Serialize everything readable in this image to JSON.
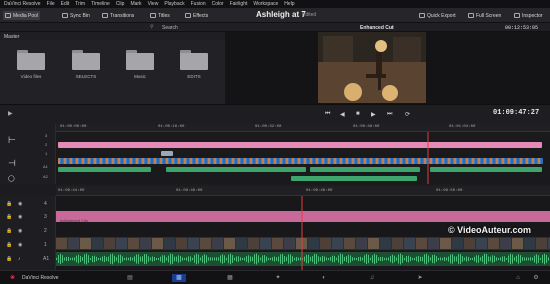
{
  "menu": [
    "DaVinci Resolve",
    "File",
    "Edit",
    "Trim",
    "Timeline",
    "Clip",
    "Mark",
    "View",
    "Playback",
    "Fusion",
    "Color",
    "Fairlight",
    "Workspace",
    "Help"
  ],
  "toolbar": {
    "media_pool": "Media Pool",
    "sync_bin": "Sync Bin",
    "transitions": "Transitions",
    "titles": "Titles",
    "effects": "Effects",
    "project_title": "Ashleigh at 7",
    "edited": "Edited",
    "quick_export": "Quick Export",
    "full_screen": "Full Screen",
    "inspector": "Inspector"
  },
  "subbar": {
    "search": "Search",
    "enhanced_cut": "Enhanced Cut",
    "timecode": "00:12:53:05"
  },
  "pool": {
    "bin": "Master",
    "folders": [
      "Video files",
      "SELECTS",
      "Music",
      "EDITS"
    ]
  },
  "transport": {
    "timecode": "01:09:47:27"
  },
  "upper_ruler": [
    "01:00:00:00",
    "01:00:16:00",
    "01:00:32:00",
    "01:00:48:00",
    "01:01:04:00"
  ],
  "lower_ruler": [
    "01:09:44:00",
    "01:09:46:00",
    "01:09:48:00",
    "01:09:50:00"
  ],
  "upper_tracks": [
    "3",
    "2",
    "1",
    "A1",
    "A2"
  ],
  "lower_tracks": [
    "4",
    "3",
    "2",
    "1",
    "A1",
    "A2"
  ],
  "clip_label": "Adjustment Clip",
  "footer": {
    "app": "DaVinci Resolve"
  },
  "watermark": "© VideoAuteur.com",
  "colors": {
    "pink": "#e58ab6",
    "green": "#3da56b",
    "blue": "#3e7fc8",
    "playhead": "#e33c3c",
    "audio_green": "#2e8a52"
  },
  "icons": [
    "media-pool-icon",
    "sync-bin-icon",
    "transitions-icon",
    "titles-icon",
    "effects-icon",
    "quick-export-icon",
    "full-screen-icon",
    "inspector-icon",
    "folder-icon",
    "play-icon",
    "stop-icon",
    "prev-icon",
    "next-icon",
    "loop-icon",
    "lock-icon",
    "eye-icon",
    "speaker-icon",
    "home-icon",
    "gear-icon"
  ]
}
